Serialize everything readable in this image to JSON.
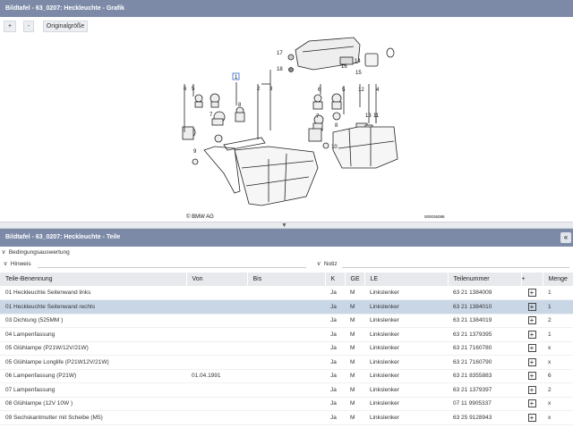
{
  "graphic_panel": {
    "title": "Bildtafel - 63_0207: Heckleuchte - Grafik",
    "zoom_in_label": "+",
    "zoom_out_label": "-",
    "original_size_label": "Originalgröße",
    "diagram": {
      "copyright": "© BMW AG",
      "drawing_code": "000036088",
      "callouts": [
        "1",
        "2",
        "3",
        "4",
        "5",
        "6",
        "7",
        "8",
        "9",
        "10",
        "11",
        "12",
        "13",
        "14",
        "15",
        "16",
        "17",
        "18"
      ]
    }
  },
  "splitter": {
    "grip_icon": "▼"
  },
  "parts_panel": {
    "title": "Bildtafel - 63_0207: Heckleuchte - Teile",
    "collapse_icon": "«",
    "criteria_label": "Bedingungsauswertung",
    "hint_label": "Hinweis",
    "notes_label": "Notiz",
    "columns": [
      "Teile-Benennung",
      "Von",
      "Bis",
      "K",
      "GE",
      "LE",
      "Teilenummer",
      "+",
      "Menge"
    ],
    "rows": [
      {
        "name": "01 Heckleuchte Seitenwand links",
        "von": "",
        "bis": "",
        "k": "Ja",
        "ge": "M",
        "le": "Linkslenker",
        "nr": "63 21 1384009",
        "menge": "1"
      },
      {
        "name": "01 Heckleuchte Seitenwand rechts",
        "von": "",
        "bis": "",
        "k": "Ja",
        "ge": "M",
        "le": "Linkslenker",
        "nr": "63 21 1384010",
        "menge": "1"
      },
      {
        "name": "03 Dichtung (525MM )",
        "von": "",
        "bis": "",
        "k": "Ja",
        "ge": "M",
        "le": "Linkslenker",
        "nr": "63 21 1384019",
        "menge": "2"
      },
      {
        "name": "04 Lampenfassung",
        "von": "",
        "bis": "",
        "k": "Ja",
        "ge": "M",
        "le": "Linkslenker",
        "nr": "63 21 1379395",
        "menge": "1"
      },
      {
        "name": "05 Glühlampe (P21W/12V/21W)",
        "von": "",
        "bis": "",
        "k": "Ja",
        "ge": "M",
        "le": "Linkslenker",
        "nr": "63 21 7160780",
        "menge": "x"
      },
      {
        "name": "05 Glühlampe Longlife (P21W12V/21W)",
        "von": "",
        "bis": "",
        "k": "Ja",
        "ge": "M",
        "le": "Linkslenker",
        "nr": "63 21 7160790",
        "menge": "x"
      },
      {
        "name": "06 Lampenfassung (P21W)",
        "von": "01.04.1991",
        "bis": "",
        "k": "Ja",
        "ge": "M",
        "le": "Linkslenker",
        "nr": "63 21 8355883",
        "menge": "6"
      },
      {
        "name": "07 Lampenfassung",
        "von": "",
        "bis": "",
        "k": "Ja",
        "ge": "M",
        "le": "Linkslenker",
        "nr": "63 21 1379397",
        "menge": "2"
      },
      {
        "name": "08 Glühlampe (12V 10W )",
        "von": "",
        "bis": "",
        "k": "Ja",
        "ge": "M",
        "le": "Linkslenker",
        "nr": "07 11 9905337",
        "menge": "x"
      },
      {
        "name": "09 Sechskantmutter mit Scheibe (M5)",
        "von": "",
        "bis": "",
        "k": "Ja",
        "ge": "M",
        "le": "Linkslenker",
        "nr": "63 25 9128943",
        "menge": "x"
      }
    ],
    "selected_row": 1,
    "add_icon": "+"
  }
}
